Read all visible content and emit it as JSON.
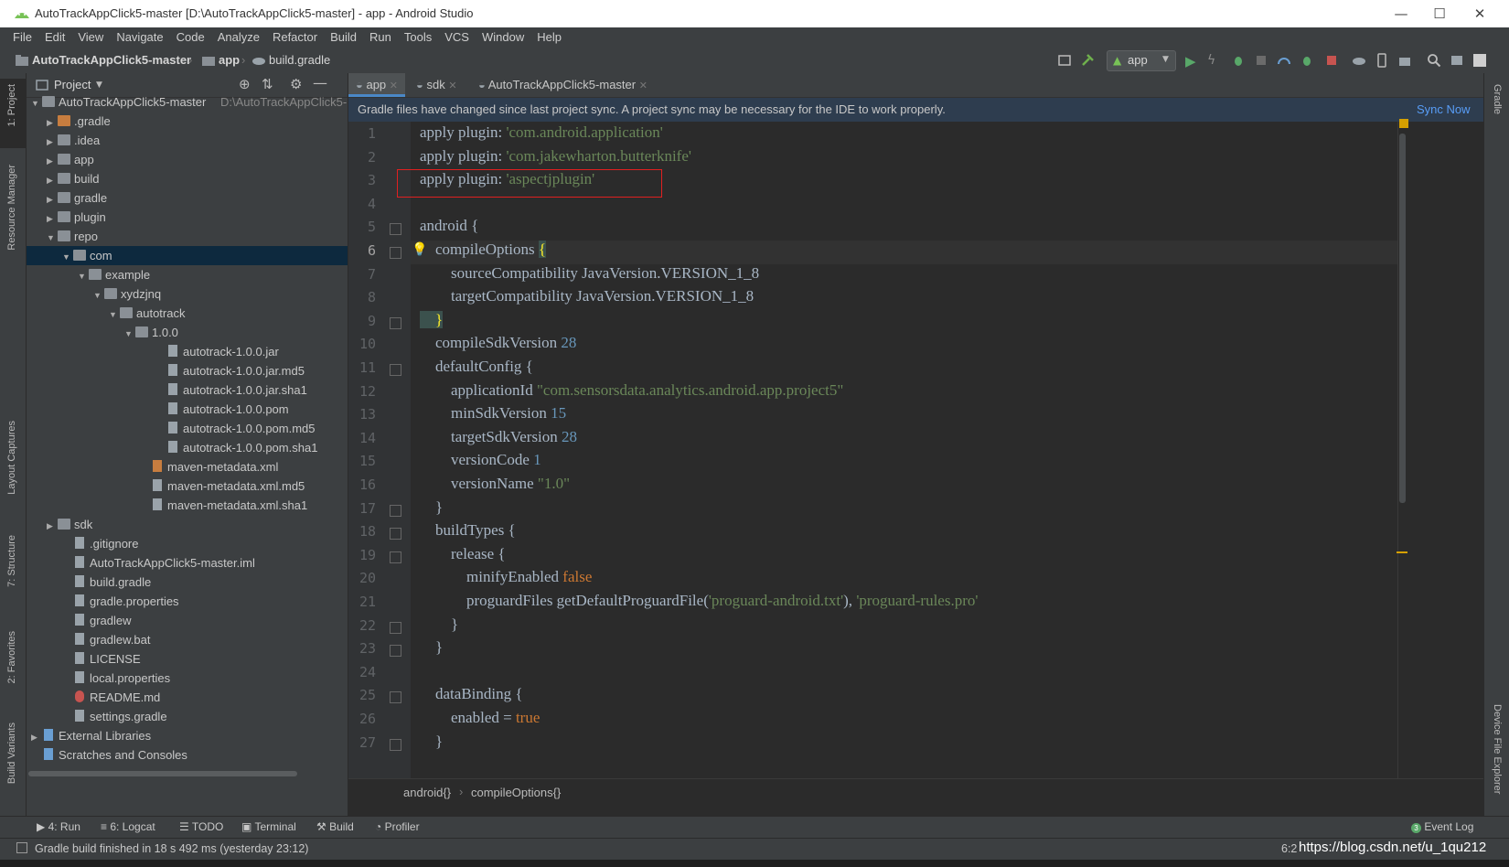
{
  "window": {
    "title": "AutoTrackAppClick5-master [D:\\AutoTrackAppClick5-master] - app - Android Studio",
    "minimize_icon": "minimize-icon",
    "maximize_icon": "maximize-icon",
    "close_icon": "close-icon"
  },
  "menu": [
    "File",
    "Edit",
    "View",
    "Navigate",
    "Code",
    "Analyze",
    "Refactor",
    "Build",
    "Run",
    "Tools",
    "VCS",
    "Window",
    "Help"
  ],
  "navbar": {
    "crumbs": [
      "AutoTrackAppClick5-master",
      "app",
      "build.gradle"
    ],
    "run_config": "app"
  },
  "left_strip": {
    "items": [
      "1: Project",
      "Resource Manager",
      "Layout Captures",
      "7: Structure",
      "2: Favorites",
      "Build Variants"
    ]
  },
  "right_strip": {
    "items": [
      "Gradle",
      "Device File Explorer"
    ]
  },
  "project_panel": {
    "title": "Project",
    "root_label": "AutoTrackAppClick5-master",
    "root_path": "D:\\AutoTrackAppClick5-",
    "rows": [
      {
        "label": ".gradle",
        "indent": 1,
        "arrow": "▶",
        "icon": "folder-orange"
      },
      {
        "label": ".idea",
        "indent": 1,
        "arrow": "▶",
        "icon": "folder"
      },
      {
        "label": "app",
        "indent": 1,
        "arrow": "▶",
        "icon": "folder"
      },
      {
        "label": "build",
        "indent": 1,
        "arrow": "▶",
        "icon": "folder"
      },
      {
        "label": "gradle",
        "indent": 1,
        "arrow": "▶",
        "icon": "folder"
      },
      {
        "label": "plugin",
        "indent": 1,
        "arrow": "▶",
        "icon": "folder"
      },
      {
        "label": "repo",
        "indent": 1,
        "arrow": "▼",
        "icon": "folder"
      },
      {
        "label": "com",
        "indent": 2,
        "arrow": "▼",
        "icon": "folder",
        "selected": true
      },
      {
        "label": "example",
        "indent": 3,
        "arrow": "▼",
        "icon": "folder"
      },
      {
        "label": "xydzjnq",
        "indent": 4,
        "arrow": "▼",
        "icon": "folder"
      },
      {
        "label": "autotrack",
        "indent": 5,
        "arrow": "▼",
        "icon": "folder"
      },
      {
        "label": "1.0.0",
        "indent": 6,
        "arrow": "▼",
        "icon": "folder"
      },
      {
        "label": "autotrack-1.0.0.jar",
        "indent": 8,
        "arrow": "",
        "icon": "file"
      },
      {
        "label": "autotrack-1.0.0.jar.md5",
        "indent": 8,
        "arrow": "",
        "icon": "file"
      },
      {
        "label": "autotrack-1.0.0.jar.sha1",
        "indent": 8,
        "arrow": "",
        "icon": "file"
      },
      {
        "label": "autotrack-1.0.0.pom",
        "indent": 8,
        "arrow": "",
        "icon": "file"
      },
      {
        "label": "autotrack-1.0.0.pom.md5",
        "indent": 8,
        "arrow": "",
        "icon": "file"
      },
      {
        "label": "autotrack-1.0.0.pom.sha1",
        "indent": 8,
        "arrow": "",
        "icon": "file"
      },
      {
        "label": "maven-metadata.xml",
        "indent": 7,
        "arrow": "",
        "icon": "xml-file"
      },
      {
        "label": "maven-metadata.xml.md5",
        "indent": 7,
        "arrow": "",
        "icon": "file"
      },
      {
        "label": "maven-metadata.xml.sha1",
        "indent": 7,
        "arrow": "",
        "icon": "file"
      },
      {
        "label": "sdk",
        "indent": 1,
        "arrow": "▶",
        "icon": "folder"
      },
      {
        "label": ".gitignore",
        "indent": 2,
        "arrow": "",
        "icon": "file"
      },
      {
        "label": "AutoTrackAppClick5-master.iml",
        "indent": 2,
        "arrow": "",
        "icon": "file"
      },
      {
        "label": "build.gradle",
        "indent": 2,
        "arrow": "",
        "icon": "gradle-file"
      },
      {
        "label": "gradle.properties",
        "indent": 2,
        "arrow": "",
        "icon": "file"
      },
      {
        "label": "gradlew",
        "indent": 2,
        "arrow": "",
        "icon": "file"
      },
      {
        "label": "gradlew.bat",
        "indent": 2,
        "arrow": "",
        "icon": "file"
      },
      {
        "label": "LICENSE",
        "indent": 2,
        "arrow": "",
        "icon": "file"
      },
      {
        "label": "local.properties",
        "indent": 2,
        "arrow": "",
        "icon": "file"
      },
      {
        "label": "README.md",
        "indent": 2,
        "arrow": "",
        "icon": "md-file"
      },
      {
        "label": "settings.gradle",
        "indent": 2,
        "arrow": "",
        "icon": "gradle-file"
      },
      {
        "label": "External Libraries",
        "indent": 0,
        "arrow": "▶",
        "icon": "library"
      },
      {
        "label": "Scratches and Consoles",
        "indent": 0,
        "arrow": "",
        "icon": "scratch"
      }
    ]
  },
  "editor": {
    "tabs": [
      {
        "label": "app",
        "active": true
      },
      {
        "label": "sdk",
        "active": false
      },
      {
        "label": "AutoTrackAppClick5-master",
        "active": false
      }
    ],
    "banner_text": "Gradle files have changed since last project sync. A project sync may be necessary for the IDE to work properly.",
    "banner_action": "Sync Now",
    "lines": [
      {
        "n": "1",
        "segs": [
          [
            "t",
            "apply plugin: "
          ],
          [
            "s",
            "'com.android.application'"
          ]
        ]
      },
      {
        "n": "2",
        "segs": [
          [
            "t",
            "apply plugin: "
          ],
          [
            "s",
            "'com.jakewharton.butterknife'"
          ]
        ]
      },
      {
        "n": "3",
        "segs": [
          [
            "t",
            "apply plugin: "
          ],
          [
            "s",
            "'aspectjplugin'"
          ]
        ]
      },
      {
        "n": "4",
        "segs": []
      },
      {
        "n": "5",
        "segs": [
          [
            "t",
            "android {"
          ]
        ]
      },
      {
        "n": "6",
        "segs": [
          [
            "t",
            "    compileOptions "
          ],
          [
            "y",
            "{"
          ]
        ]
      },
      {
        "n": "7",
        "segs": [
          [
            "t",
            "        sourceCompatibility JavaVersion.VERSION_1_8"
          ]
        ]
      },
      {
        "n": "8",
        "segs": [
          [
            "t",
            "        targetCompatibility JavaVersion.VERSION_1_8"
          ]
        ]
      },
      {
        "n": "9",
        "segs": [
          [
            "y",
            "    }"
          ]
        ]
      },
      {
        "n": "10",
        "segs": [
          [
            "t",
            "    compileSdkVersion "
          ],
          [
            "n",
            "28"
          ]
        ]
      },
      {
        "n": "11",
        "segs": [
          [
            "t",
            "    defaultConfig {"
          ]
        ]
      },
      {
        "n": "12",
        "segs": [
          [
            "t",
            "        applicationId "
          ],
          [
            "s",
            "\"com.sensorsdata.analytics.android.app.project5\""
          ]
        ]
      },
      {
        "n": "13",
        "segs": [
          [
            "t",
            "        minSdkVersion "
          ],
          [
            "n",
            "15"
          ]
        ]
      },
      {
        "n": "14",
        "segs": [
          [
            "t",
            "        targetSdkVersion "
          ],
          [
            "n",
            "28"
          ]
        ]
      },
      {
        "n": "15",
        "segs": [
          [
            "t",
            "        versionCode "
          ],
          [
            "n",
            "1"
          ]
        ]
      },
      {
        "n": "16",
        "segs": [
          [
            "t",
            "        versionName "
          ],
          [
            "s",
            "\"1.0\""
          ]
        ]
      },
      {
        "n": "17",
        "segs": [
          [
            "t",
            "    }"
          ]
        ]
      },
      {
        "n": "18",
        "segs": [
          [
            "t",
            "    buildTypes {"
          ]
        ]
      },
      {
        "n": "19",
        "segs": [
          [
            "t",
            "        release {"
          ]
        ]
      },
      {
        "n": "20",
        "segs": [
          [
            "t",
            "            minifyEnabled "
          ],
          [
            "k",
            "false"
          ]
        ]
      },
      {
        "n": "21",
        "segs": [
          [
            "t",
            "            proguardFiles getDefaultProguardFile("
          ],
          [
            "s",
            "'proguard-android.txt'"
          ],
          [
            "t",
            "), "
          ],
          [
            "s",
            "'proguard-rules.pro'"
          ]
        ]
      },
      {
        "n": "22",
        "segs": [
          [
            "t",
            "        }"
          ]
        ]
      },
      {
        "n": "23",
        "segs": [
          [
            "t",
            "    }"
          ]
        ]
      },
      {
        "n": "24",
        "segs": []
      },
      {
        "n": "25",
        "segs": [
          [
            "t",
            "    dataBinding {"
          ]
        ]
      },
      {
        "n": "26",
        "segs": [
          [
            "t",
            "        enabled = "
          ],
          [
            "k",
            "true"
          ]
        ]
      },
      {
        "n": "27",
        "segs": [
          [
            "t",
            "    }"
          ]
        ]
      }
    ],
    "breadcrumb": [
      "android{}",
      "compileOptions{}"
    ]
  },
  "bottom_tabs": [
    "4: Run",
    "6: Logcat",
    "TODO",
    "Terminal",
    "Build",
    "Profiler"
  ],
  "event_log": "Event Log",
  "status": {
    "message": "Gradle build finished in 18 s 492 ms (yesterday 23:12)",
    "position": "6:2",
    "watermark": "https://blog.csdn.net/u_1qu212"
  }
}
